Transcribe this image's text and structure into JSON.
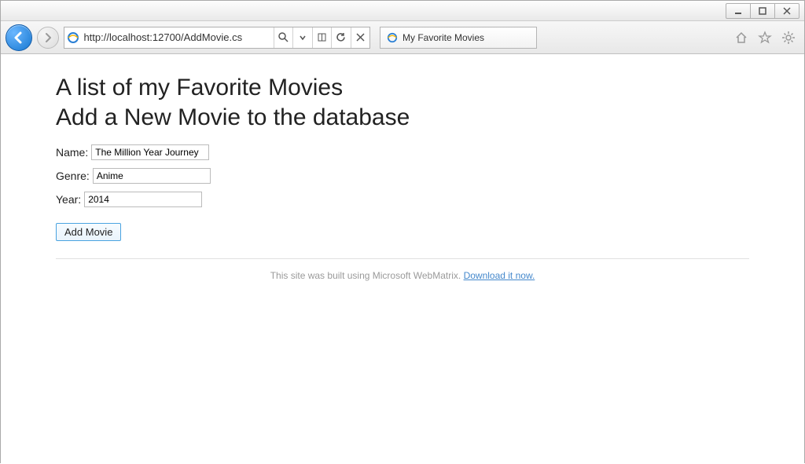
{
  "window": {
    "minimize": "—",
    "maximize": "▢",
    "close": "✕"
  },
  "addressbar": {
    "url": "http://localhost:12700/AddMovie.cs"
  },
  "tab": {
    "title": "My Favorite Movies"
  },
  "page": {
    "heading1": "A list of my Favorite Movies",
    "heading2": "Add a New Movie to the database",
    "form": {
      "name_label": "Name:",
      "name_value": "The Million Year Journey",
      "genre_label": "Genre:",
      "genre_value": "Anime",
      "year_label": "Year:",
      "year_value": "2014",
      "submit_label": "Add Movie"
    },
    "footer_text": "This site was built using Microsoft WebMatrix. ",
    "footer_link": "Download it now."
  }
}
